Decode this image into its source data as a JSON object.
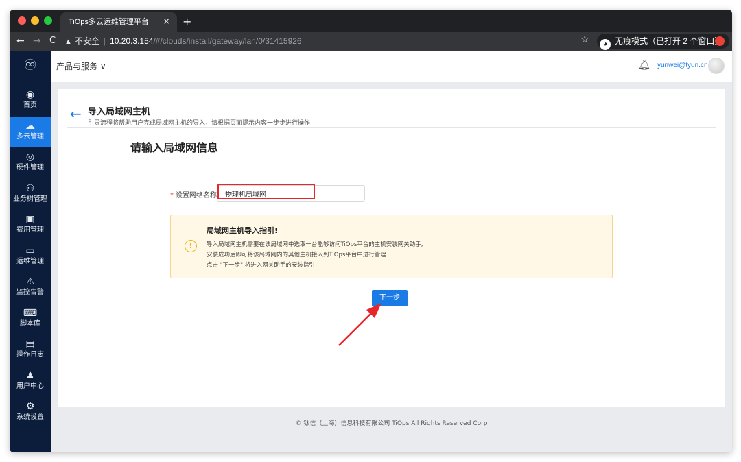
{
  "browser": {
    "tab_title": "TiOps多云运维管理平台",
    "tab_close": "×",
    "new_tab": "+",
    "security_label": "不安全",
    "url_host": "10.20.3.154",
    "url_path": "/#/clouds/install/gateway/lan/0/31415926",
    "incognito_label": "无痕模式（已打开 2 个窗口）"
  },
  "sidebar": {
    "items": [
      {
        "label": "首页",
        "icon": "dashboard-icon",
        "glyph": "◉"
      },
      {
        "label": "多云管理",
        "icon": "cloud-icon",
        "glyph": "☁",
        "active": true
      },
      {
        "label": "硬件管理",
        "icon": "hardware-icon",
        "glyph": "◎"
      },
      {
        "label": "业务树管理",
        "icon": "tree-icon",
        "glyph": "⚇"
      },
      {
        "label": "费用管理",
        "icon": "billing-icon",
        "glyph": "▣"
      },
      {
        "label": "运维管理",
        "icon": "monitor-icon",
        "glyph": "▭"
      },
      {
        "label": "监控告警",
        "icon": "alert-icon",
        "glyph": "⚠"
      },
      {
        "label": "脚本库",
        "icon": "script-icon",
        "glyph": "⌨"
      },
      {
        "label": "操作日志",
        "icon": "log-icon",
        "glyph": "▤"
      },
      {
        "label": "用户中心",
        "icon": "user-icon",
        "glyph": "♟"
      },
      {
        "label": "系统设置",
        "icon": "settings-icon",
        "glyph": "⚙"
      }
    ]
  },
  "header": {
    "products_label": "产品与服务 ∨",
    "user_email": "yunwei@tyun.cn"
  },
  "page": {
    "title": "导入局域网主机",
    "subtitle": "引导流程将帮助用户完成局域网主机的导入，请根据页面提示内容一步步进行操作",
    "section_title": "请输入局域网信息",
    "network_label": "设置网络名称",
    "network_value": "物理机局域网",
    "guide_title": "局域网主机导入指引!",
    "guide_lines": [
      "导入局域网主机需要在该局域网中选取一台能够访问TiOps平台的主机安装网关助手,",
      "安装成功后即可将该局域网内的其他主机接入到TiOps平台中进行管理",
      "点击 \"下一步\" 将进入网关助手的安装指引"
    ],
    "next_button": "下一步"
  },
  "footer": {
    "text": "© 钛信（上海）信息科技有限公司 TiOps All Rights Reserved Corp"
  },
  "colors": {
    "accent": "#1a7ae6",
    "sidebar_bg": "#0b1d3a",
    "annotation_red": "#e5262c",
    "guide_bg": "#fff8e6"
  }
}
